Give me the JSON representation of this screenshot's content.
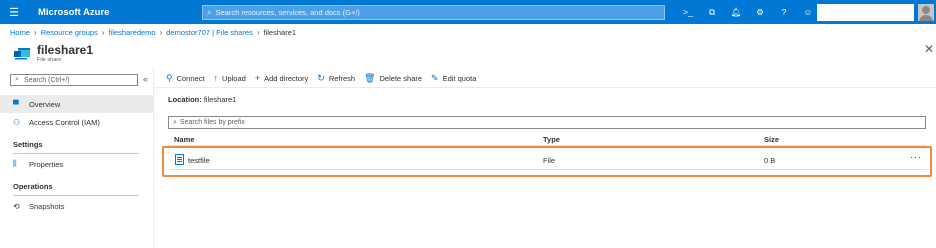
{
  "header": {
    "menu_icon": "hamburger-icon",
    "brand": "Microsoft Azure",
    "search_placeholder": "Search resources, services, and docs (G+/)",
    "icons": [
      "cloud-shell-icon",
      "directory-filter-icon",
      "notifications-icon",
      "settings-icon",
      "help-icon",
      "feedback-icon"
    ]
  },
  "breadcrumb": {
    "items": [
      "Home",
      "Resource groups",
      "filesharedemo",
      "demostor707 | File shares"
    ],
    "current": "fileshare1"
  },
  "title": {
    "name": "fileshare1",
    "subtitle": "File share"
  },
  "sidebar": {
    "search_placeholder": "Search (Ctrl+/)",
    "items": [
      {
        "label": "Overview",
        "active": true
      },
      {
        "label": "Access Control (IAM)"
      }
    ],
    "sections": [
      {
        "heading": "Settings",
        "items": [
          {
            "label": "Properties"
          }
        ]
      },
      {
        "heading": "Operations",
        "items": [
          {
            "label": "Snapshots"
          }
        ]
      }
    ]
  },
  "toolbar": {
    "connect": "Connect",
    "upload": "Upload",
    "add_directory": "Add directory",
    "refresh": "Refresh",
    "delete_share": "Delete share",
    "edit_quota": "Edit quota"
  },
  "content": {
    "location_label": "Location:",
    "location_value": "fileshare1",
    "search_placeholder": "Search files by prefix",
    "columns": [
      "Name",
      "Type",
      "Size"
    ],
    "rows": [
      {
        "name": "testfile",
        "type": "File",
        "size": "0 B",
        "more": "···"
      }
    ],
    "highlight_color": "#f08a3c"
  },
  "colors": {
    "accent": "#0078d4"
  }
}
